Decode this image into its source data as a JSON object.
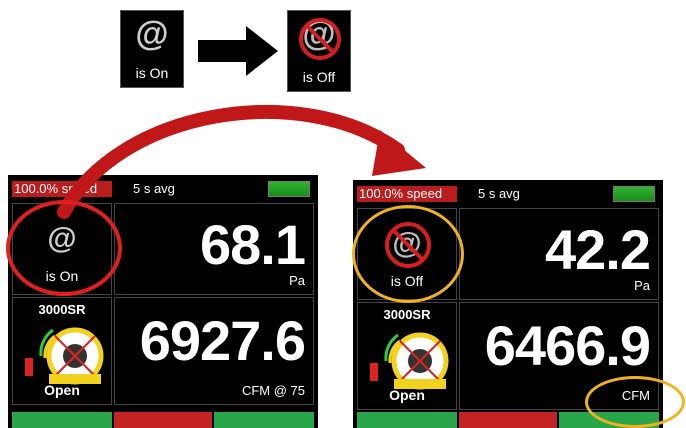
{
  "legend": {
    "on_symbol": "@",
    "on_caption": "is On",
    "off_symbol": "@",
    "off_caption": "is Off"
  },
  "left_panel": {
    "speed": "100.0% speed",
    "avg": "5 s avg",
    "at_symbol": "@",
    "at_caption": "is On",
    "pressure": "68.1",
    "pressure_unit": "Pa",
    "ring_label": "3000SR",
    "ring_state": "Open",
    "flow": "6927.6",
    "flow_unit": "CFM @ 75"
  },
  "right_panel": {
    "speed": "100.0% speed",
    "avg": "5 s avg",
    "at_symbol": "@",
    "at_caption": "is Off",
    "pressure": "42.2",
    "pressure_unit": "Pa",
    "ring_label": "3000SR",
    "ring_state": "Open",
    "flow": "6466.9",
    "flow_unit": "CFM"
  },
  "colors": {
    "highlight_red": "#e02020",
    "highlight_yellow": "#f2b21e",
    "speed_bar": "#b91d1d",
    "battery": "#2fb42f"
  }
}
